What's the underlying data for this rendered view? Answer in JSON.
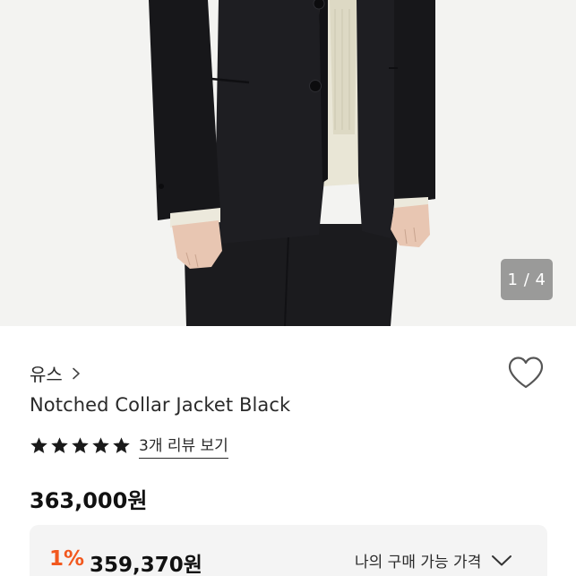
{
  "gallery": {
    "counter_current": "1",
    "counter_separator": " / ",
    "counter_total": "4",
    "image_subject": "model wearing black notched collar jacket over cream knit, black trousers"
  },
  "product": {
    "brand": "유스",
    "brand_chevron_icon": "chevron-right-icon",
    "wishlist_icon": "heart-outline-icon",
    "name": "Notched Collar Jacket Black",
    "rating_stars": 5,
    "rating_max": 5,
    "star_icon": "star-filled-icon",
    "review_link": "3개 리뷰 보기",
    "price": "363,000원"
  },
  "discount": {
    "rate": "1%",
    "price": "359,370원",
    "my_price_label": "나의 구매 가능 가격",
    "expand_icon": "chevron-down-icon"
  },
  "colors": {
    "background": "#ffffff",
    "gallery_bg": "#f3f3f1",
    "discount_accent": "#f2581e",
    "discount_box_bg": "#f4f4f4",
    "text": "#1a1a1a"
  }
}
